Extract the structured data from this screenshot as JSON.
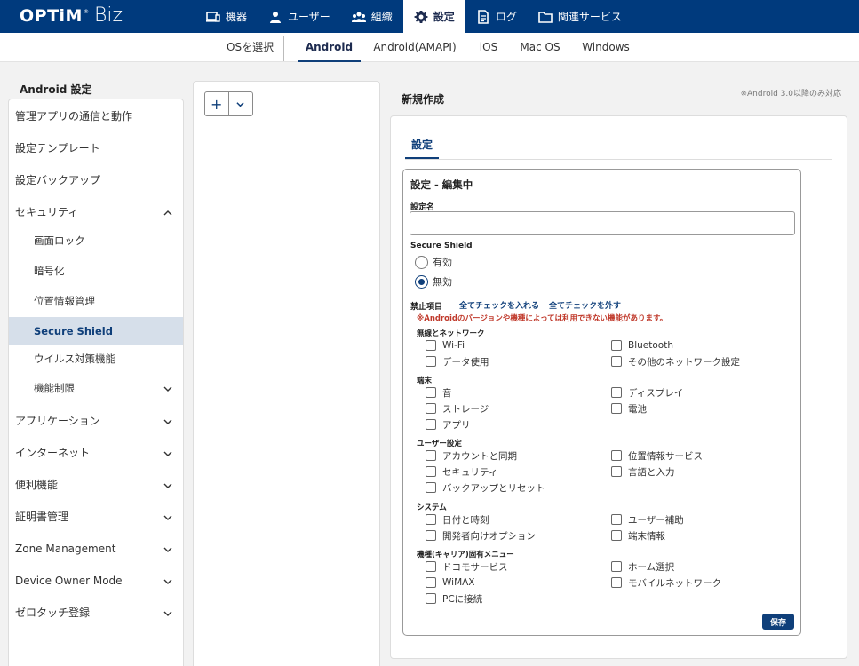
{
  "logo": {
    "brand": "OPTiM",
    "reg": "®",
    "product": "Biz"
  },
  "nav": [
    {
      "label": "機器",
      "icon": "device-icon"
    },
    {
      "label": "ユーザー",
      "icon": "user-icon"
    },
    {
      "label": "組織",
      "icon": "organization-icon"
    },
    {
      "label": "設定",
      "icon": "gear-icon",
      "active": true
    },
    {
      "label": "ログ",
      "icon": "log-icon"
    },
    {
      "label": "関連サービス",
      "icon": "folder-icon"
    }
  ],
  "subnav": {
    "os_label": "OSを選択",
    "tabs": [
      "Android",
      "Android(AMAPI)",
      "iOS",
      "Mac OS",
      "Windows"
    ],
    "active": "Android"
  },
  "sidebar": {
    "title": "Android 設定",
    "items": [
      {
        "label": "管理アプリの通信と動作"
      },
      {
        "label": "設定テンプレート"
      },
      {
        "label": "設定バックアップ"
      },
      {
        "label": "セキュリティ",
        "expanded": true
      },
      {
        "label": "画面ロック"
      },
      {
        "label": "暗号化"
      },
      {
        "label": "位置情報管理"
      },
      {
        "label": "Secure Shield",
        "active": true
      },
      {
        "label": "ウイルス対策機能"
      },
      {
        "label": "機能制限",
        "collapsed": true
      },
      {
        "label": "アプリケーション",
        "collapsed": true
      },
      {
        "label": "インターネット",
        "collapsed": true
      },
      {
        "label": "便利機能",
        "collapsed": true
      },
      {
        "label": "証明書管理",
        "collapsed": true
      },
      {
        "label": "Zone Management",
        "collapsed": true
      },
      {
        "label": "Device Owner Mode",
        "collapsed": true
      },
      {
        "label": "ゼロタッチ登録",
        "collapsed": true
      }
    ]
  },
  "middle": {
    "add_label": "+"
  },
  "main": {
    "title": "新規作成",
    "note": "※Android 3.0以降のみ対応",
    "tab": "設定",
    "edit_title": "設定 - 編集中",
    "name_label": "設定名",
    "name_value": "",
    "shield_label": "Secure Shield",
    "radio_on": "有効",
    "radio_off": "無効",
    "selected": "無効",
    "prohibited_label": "禁止項目",
    "check_all": "全てチェックを入れる",
    "uncheck_all": "全てチェックを外す",
    "warning": "※Androidのバージョンや機種によっては利用できない機能があります。",
    "categories": [
      {
        "name": "無線とネットワーク",
        "items": [
          "Wi-Fi",
          "Bluetooth",
          "データ使用",
          "その他のネットワーク設定"
        ]
      },
      {
        "name": "端末",
        "items": [
          "音",
          "ディスプレイ",
          "ストレージ",
          "電池",
          "アプリ"
        ]
      },
      {
        "name": "ユーザー設定",
        "items": [
          "アカウントと同期",
          "位置情報サービス",
          "セキュリティ",
          "言語と入力",
          "バックアップとリセット"
        ]
      },
      {
        "name": "システム",
        "items": [
          "日付と時刻",
          "ユーザー補助",
          "開発者向けオプション",
          "端末情報"
        ]
      },
      {
        "name": "機種(キャリア)固有メニュー",
        "items": [
          "ドコモサービス",
          "ホーム選択",
          "WiMAX",
          "モバイルネットワーク",
          "PCに接続"
        ]
      }
    ],
    "save_label": "保存"
  },
  "colors": {
    "nav_bg": "#003a7d",
    "accent": "#0f3f7a",
    "warning": "#c0392b",
    "active_bg": "#d6dfea"
  }
}
